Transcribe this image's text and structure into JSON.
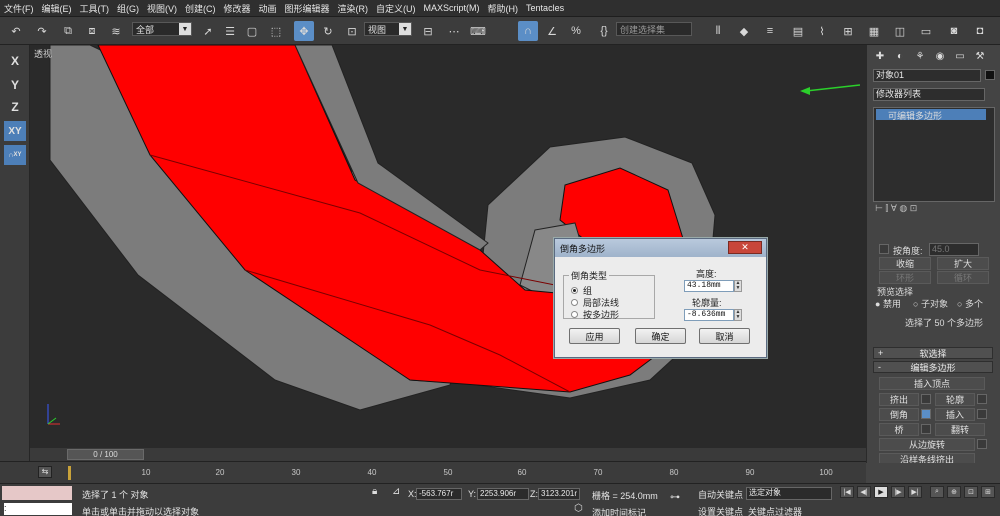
{
  "menu": [
    "文件(F)",
    "编辑(E)",
    "工具(T)",
    "组(G)",
    "视图(V)",
    "创建(C)",
    "修改器",
    "动画",
    "图形编辑器",
    "渲染(R)",
    "自定义(U)",
    "MAXScript(M)",
    "帮助(H)",
    "Tentacles"
  ],
  "toolbar": {
    "selection_filter": "全部",
    "ref_coord": "视图",
    "named_selection": "创建选择集"
  },
  "axes": {
    "x": "X",
    "y": "Y",
    "z": "Z",
    "xy": "XY",
    "xy2": "XY"
  },
  "viewport": {
    "label": "透视"
  },
  "dialog": {
    "title": "倒角多边形",
    "close": "✕",
    "type_group": "倒角类型",
    "options": [
      "组",
      "局部法线",
      "按多边形"
    ],
    "selected_option": 0,
    "height_label": "高度:",
    "height_value": "43.18mm",
    "outline_label": "轮廓量:",
    "outline_value": "-8.636mm",
    "apply": "应用",
    "ok": "确定",
    "cancel": "取消"
  },
  "panel": {
    "object_name": "对象01",
    "modifier_list": "修改器列表",
    "stack_item": "可编辑多边形",
    "smooth_label": "按角度:",
    "smooth_value": "45.0",
    "shrink": "收缩",
    "grow": "扩大",
    "ring": "环形",
    "loop": "循环",
    "preview_label": "预览选择",
    "preview_options": [
      "禁用",
      "子对象",
      "多个"
    ],
    "selection_info": "选择了 50 个多边形",
    "rollout_soft": "软选择",
    "rollout_edit": "编辑多边形",
    "insert_vertex": "插入顶点",
    "extrude": "挤出",
    "outline": "轮廓",
    "bevel": "倒角",
    "inset": "插入",
    "bridge": "桥",
    "flip": "翻转",
    "hinge": "从边旋转",
    "extrude_spline": "沿样条线挤出"
  },
  "timeline": {
    "frame": "0 / 100",
    "ticks": [
      "10",
      "20",
      "30",
      "40",
      "50",
      "60",
      "70",
      "80",
      "90",
      "100"
    ]
  },
  "status": {
    "selected": "选择了 1 个 对象",
    "hint": "单击或单击并拖动以选择对象",
    "x_label": "X:",
    "x_value": "-563.767r",
    "y_label": "Y:",
    "y_value": "2253.906r",
    "z_label": "Z:",
    "z_value": "3123.201r",
    "grid": "栅格 = 254.0mm",
    "auto_key": "自动关键点",
    "set_key": "设置关键点",
    "selected_dd": "选定对象",
    "key_filter": "关键点过滤器",
    "add_time_tag": "添加时间标记",
    "colon": ":"
  },
  "colors": {
    "face_red": "#ff0000",
    "border_gray": "#7c7c7c",
    "viewport_bg": "#2a2a2a",
    "active_blue": "#5b8ec6"
  }
}
